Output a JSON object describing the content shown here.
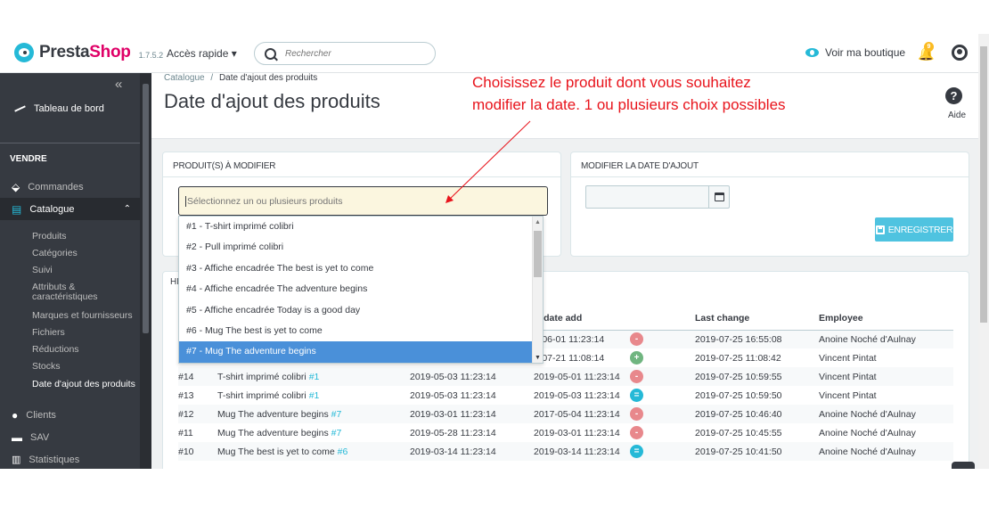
{
  "header": {
    "logo_main": "Presta",
    "logo_shop": "Shop",
    "version": "1.7.5.2",
    "quick_access": "Accès rapide ▾",
    "search_placeholder": "Rechercher",
    "view_shop": "Voir ma boutique",
    "notification_count": "9"
  },
  "sidebar": {
    "collapse": "«",
    "dashboard": "Tableau de bord",
    "section": "VENDRE",
    "orders": "Commandes",
    "catalog": "Catalogue",
    "catalog_arrow": "⌃",
    "sub_items": [
      "Produits",
      "Catégories",
      "Suivi",
      "Attributs &",
      "caractéristiques",
      "Marques et fournisseurs",
      "Fichiers",
      "Réductions",
      "Stocks",
      "Date d'ajout des produits"
    ],
    "customers": "Clients",
    "sav": "SAV",
    "stats": "Statistiques"
  },
  "page": {
    "breadcrumb_parent": "Catalogue",
    "breadcrumb_sep": "/",
    "breadcrumb_current": "Date d'ajout des produits",
    "title": "Date d'ajout des produits",
    "help_icon": "?",
    "help_label": "Aide"
  },
  "annotation": {
    "line1": "Choisissez le produit dont vous souhaitez",
    "line2": "modifier la date. 1 ou plusieurs choix possibles",
    "color": "#e8141c"
  },
  "products_card": {
    "header": "PRODUIT(S) À MODIFIER",
    "select_placeholder": "Sélectionnez un ou plusieurs produits",
    "options": [
      "#1 - T-shirt imprimé colibri",
      "#2 - Pull imprimé colibri",
      "#3 - Affiche encadrée The best is yet to come",
      "#4 - Affiche encadrée The adventure begins",
      "#5 - Affiche encadrée Today is a good day",
      "#6 - Mug The best is yet to come",
      "#7 - Mug The adventure begins"
    ],
    "selected_index": 6
  },
  "date_card": {
    "header": "MODIFIER LA DATE D'AJOUT",
    "save_label": "ENREGISTRER"
  },
  "history": {
    "label": "HI",
    "columns": [
      "w date add",
      "Last change",
      "Employee"
    ],
    "rows": [
      {
        "id": "",
        "product": "",
        "ref": "",
        "old": "",
        "new": "8-06-01 11:23:14",
        "status": "minus",
        "last": "2019-07-25 16:55:08",
        "employee": "Anoine Noché d'Aulnay"
      },
      {
        "id": "",
        "product": "",
        "ref": "",
        "old": "",
        "new": "9-07-21 11:08:14",
        "status": "plus",
        "last": "2019-07-25 11:08:42",
        "employee": "Vincent Pintat"
      },
      {
        "id": "#14",
        "product": "T-shirt imprimé colibri ",
        "ref": "#1",
        "old": "2019-05-03 11:23:14",
        "new": "2019-05-01 11:23:14",
        "status": "minus",
        "last": "2019-07-25 10:59:55",
        "employee": "Vincent Pintat"
      },
      {
        "id": "#13",
        "product": "T-shirt imprimé colibri ",
        "ref": "#1",
        "old": "2019-05-03 11:23:14",
        "new": "2019-05-03 11:23:14",
        "status": "equal",
        "last": "2019-07-25 10:59:50",
        "employee": "Vincent Pintat"
      },
      {
        "id": "#12",
        "product": "Mug The adventure begins ",
        "ref": "#7",
        "old": "2019-03-01 11:23:14",
        "new": "2017-05-04 11:23:14",
        "status": "minus",
        "last": "2019-07-25 10:46:40",
        "employee": "Anoine Noché d'Aulnay"
      },
      {
        "id": "#11",
        "product": "Mug The adventure begins ",
        "ref": "#7",
        "old": "2019-05-28 11:23:14",
        "new": "2019-03-01 11:23:14",
        "status": "minus",
        "last": "2019-07-25 10:45:55",
        "employee": "Anoine Noché d'Aulnay"
      },
      {
        "id": "#10",
        "product": "Mug The best is yet to come ",
        "ref": "#6",
        "old": "2019-03-14 11:23:14",
        "new": "2019-03-14 11:23:14",
        "status": "equal",
        "last": "2019-07-25 10:41:50",
        "employee": "Anoine Noché d'Aulnay"
      }
    ]
  },
  "icons": {
    "search": "search-icon",
    "eye": "eye-icon",
    "bell": "bell-icon",
    "user": "user-icon",
    "calendar": "calendar-icon",
    "save": "floppy-icon"
  },
  "colors": {
    "accent": "#25b9d7",
    "sidebar_bg": "#363a41",
    "selected_option": "#4a90d9",
    "save_button": "#4fc3e0"
  }
}
